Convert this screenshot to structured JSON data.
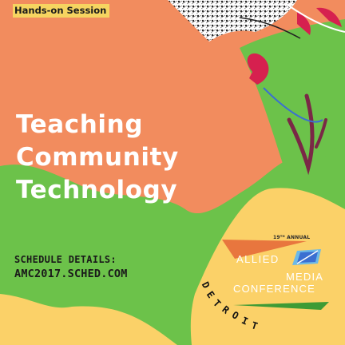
{
  "colors": {
    "orange": "#f28c5e",
    "green": "#6cc24a",
    "yellow": "#fbd168",
    "badge_yellow": "#f6d460",
    "magenta": "#d6204f",
    "dark_text": "#1a1a1a",
    "white": "#ffffff",
    "blue": "#3b6fd1"
  },
  "badge": {
    "label": "Hands-on Session"
  },
  "title": {
    "lines": [
      "Teaching",
      "Community",
      "Technology"
    ]
  },
  "schedule": {
    "label": "SCHEDULE DETAILS:",
    "url": "AMC2017.SCHED.COM"
  },
  "conference": {
    "annual": "19ᵀᴴ ANNUAL",
    "line1": "ALLIED",
    "line2": "MEDIA",
    "line3": "CONFERENCE",
    "city": "DETROIT"
  },
  "icons": {
    "logo": "amc-pennant-logo",
    "scribble": "decorative-scribble"
  }
}
